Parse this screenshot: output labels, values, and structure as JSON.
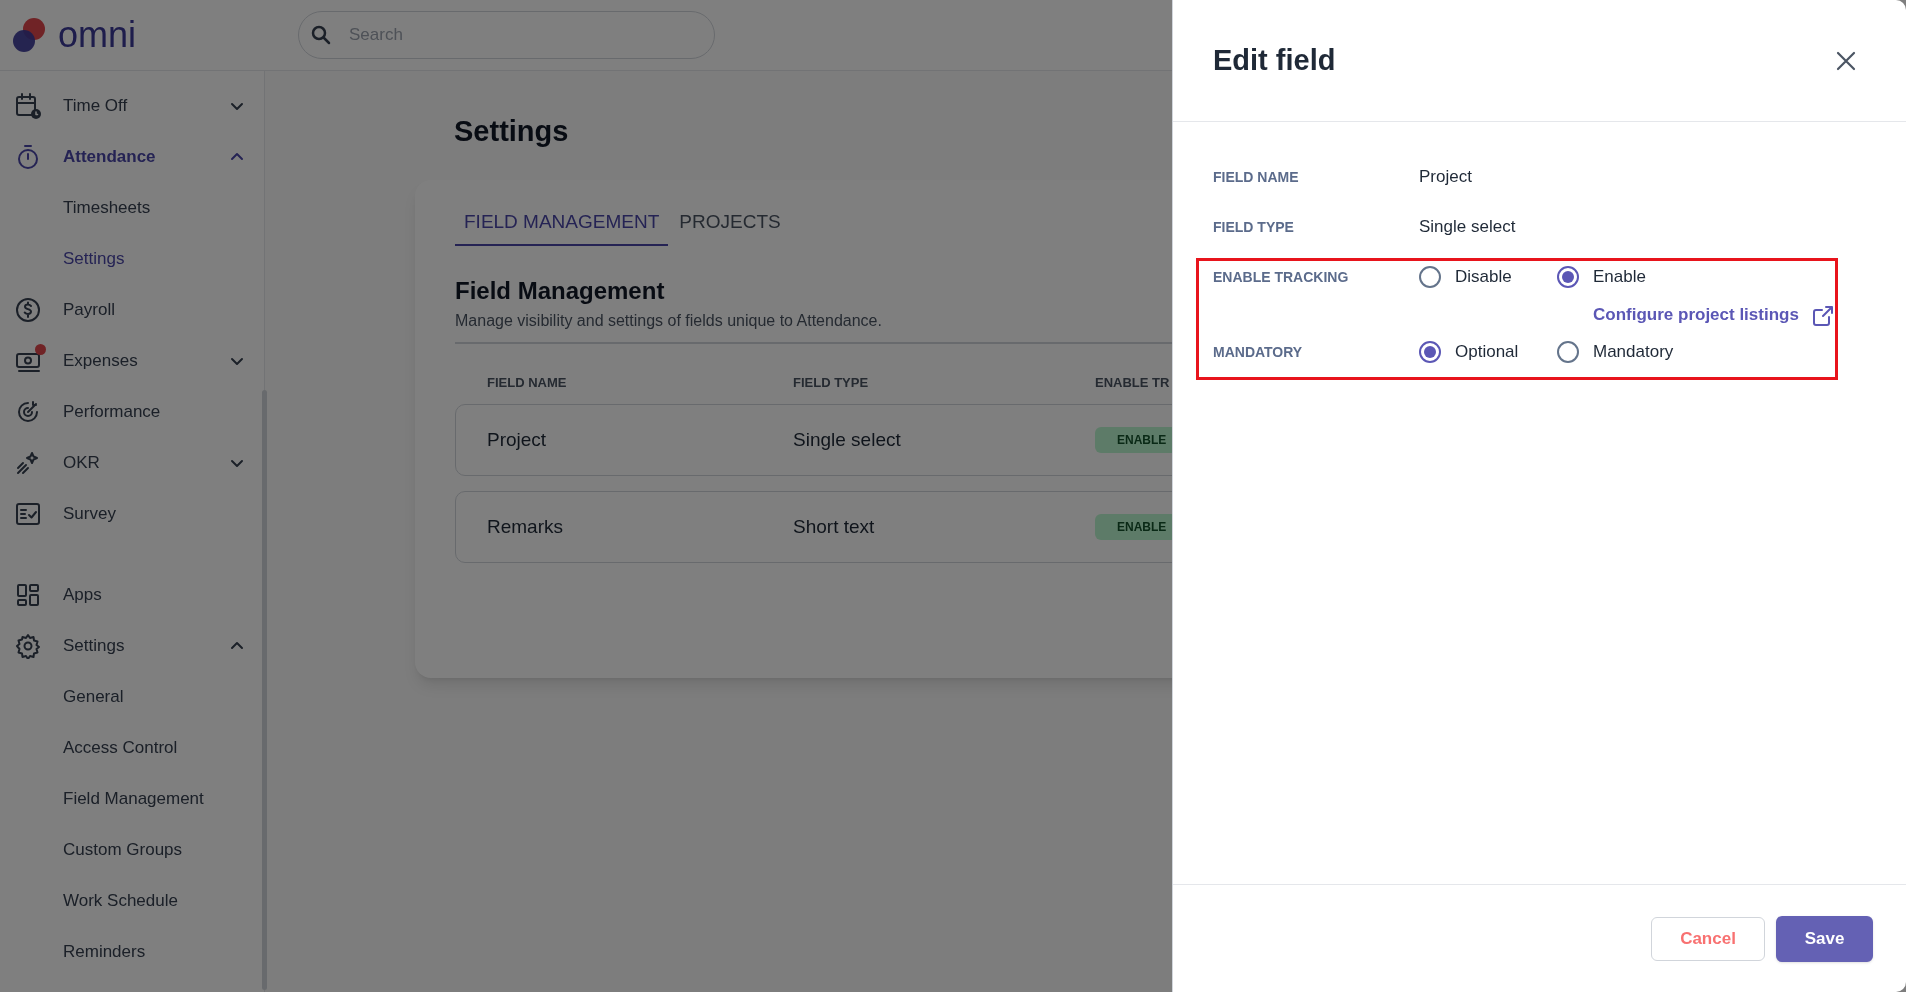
{
  "app": {
    "logo": "omni"
  },
  "search": {
    "placeholder": "Search"
  },
  "sidebar": {
    "groups": [
      [
        {
          "label": "Time Off",
          "kind": "group",
          "expanded": false,
          "selected": false,
          "notification": false
        },
        {
          "label": "Attendance",
          "kind": "group",
          "expanded": true,
          "selected": true,
          "notification": false,
          "children": [
            {
              "label": "Timesheets",
              "selected": false
            },
            {
              "label": "Settings",
              "selected": true
            }
          ]
        },
        {
          "label": "Payroll",
          "kind": "link",
          "selected": false,
          "notification": false
        },
        {
          "label": "Expenses",
          "kind": "group",
          "expanded": false,
          "selected": false,
          "notification": true
        },
        {
          "label": "Performance",
          "kind": "link",
          "selected": false,
          "notification": false
        },
        {
          "label": "OKR",
          "kind": "group",
          "expanded": false,
          "selected": false,
          "notification": false
        },
        {
          "label": "Survey",
          "kind": "link",
          "selected": false,
          "notification": false
        }
      ],
      [
        {
          "label": "Apps",
          "kind": "link",
          "selected": false,
          "notification": false
        },
        {
          "label": "Settings",
          "kind": "group",
          "expanded": true,
          "selected": false,
          "notification": false,
          "children": [
            {
              "label": "General",
              "selected": false
            },
            {
              "label": "Access Control",
              "selected": false
            },
            {
              "label": "Field Management",
              "selected": false
            },
            {
              "label": "Custom Groups",
              "selected": false
            },
            {
              "label": "Work Schedule",
              "selected": false
            },
            {
              "label": "Reminders",
              "selected": false
            }
          ]
        }
      ]
    ]
  },
  "page": {
    "title": "Settings",
    "tabs": [
      {
        "label": "FIELD MANAGEMENT",
        "selected": true
      },
      {
        "label": "PROJECTS",
        "selected": false
      }
    ],
    "section": {
      "title": "Field Management",
      "description": "Manage visibility and settings of fields unique to Attendance."
    },
    "table": {
      "columns": [
        "FIELD NAME",
        "FIELD TYPE",
        "ENABLE TR"
      ],
      "rows": [
        {
          "cells": [
            "Project",
            "Single select"
          ],
          "status": "ENABLE"
        },
        {
          "cells": [
            "Remarks",
            "Short text"
          ],
          "status": "ENABLE"
        }
      ]
    }
  },
  "panel": {
    "title": "Edit field",
    "fields": [
      {
        "label": "FIELD NAME",
        "kind": "text",
        "value": "Project",
        "highlighted": false
      },
      {
        "label": "FIELD TYPE",
        "kind": "text",
        "value": "Single select",
        "highlighted": false
      },
      {
        "label": "ENABLE TRACKING",
        "kind": "radio",
        "highlighted": true,
        "options": [
          {
            "label": "Disable",
            "selected": false
          },
          {
            "label": "Enable",
            "selected": true
          }
        ],
        "link": {
          "label": "Configure project listings"
        }
      },
      {
        "label": "MANDATORY",
        "kind": "radio",
        "highlighted": true,
        "options": [
          {
            "label": "Optional",
            "selected": true
          },
          {
            "label": "Mandatory",
            "selected": false
          }
        ]
      }
    ],
    "actions": [
      {
        "label": "Cancel",
        "kind": "secondary"
      },
      {
        "label": "Save",
        "kind": "primary"
      }
    ]
  }
}
